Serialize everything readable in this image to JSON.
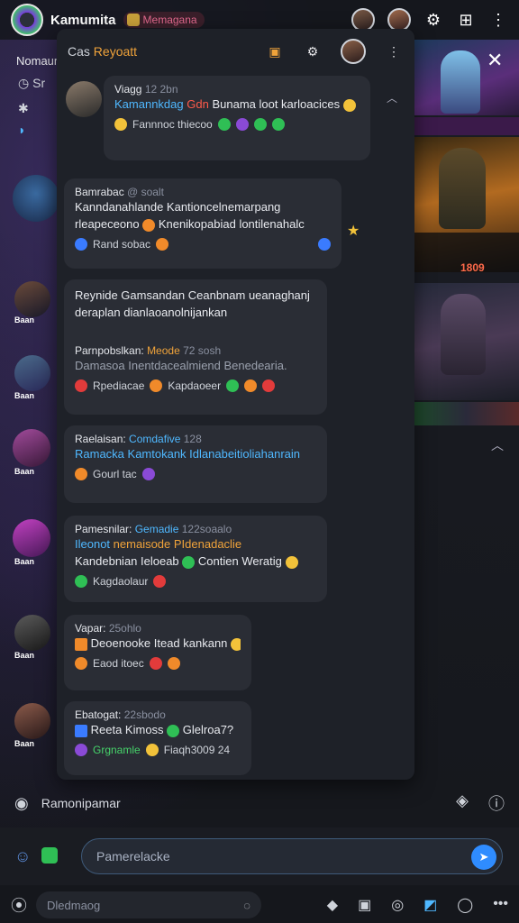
{
  "app": {
    "title": "Kamumita",
    "badge": "Memagana"
  },
  "rail": {
    "title": "Nomaun",
    "row1": "Sr",
    "labels": [
      "Baan",
      "Baan",
      "Baan",
      "Baan",
      "Baan",
      "Baan"
    ]
  },
  "panel": {
    "title_prefix": "Cas",
    "title_accent": "Reyoatt"
  },
  "messages": [
    {
      "name": "Viagg",
      "meta": "12 2bn",
      "line1_blue": "Kamannkdag",
      "line1_red": "Gdn",
      "line1_rest": "Bunama loot karloacices",
      "foot_text": "Fannnoc thiecoo"
    },
    {
      "name": "Bamrabac",
      "meta": "@ soalt",
      "line1": "Kanndanahlande Kantioncelnemarpang",
      "line2": "rleapeceono",
      "line2_rest": "Knenikopabiad lontilenahalc",
      "foot_text": "Rand sobac"
    },
    {
      "line1": "Reynide Gamsandan Ceanbnam ueanaghanj",
      "line2": "deraplan dianlaoanolnijankan",
      "name": "Parnpobslkan:",
      "meta_orange": "Meode",
      "meta": "72 sosh",
      "line3": "Damasoa Inentdacealmiend Benedearia.",
      "foot_text": "Rpediacae",
      "foot_text2": "Kapdaoeer"
    },
    {
      "name": "Raelaisan:",
      "meta_blue": "Comdafive",
      "meta": "128",
      "line1": "Ramacka Kamtokank Idlanabeitioliahanrain",
      "foot_text": "Gourl tac"
    },
    {
      "name": "Pamesnilar:",
      "meta_blue": "Gemadie",
      "meta": "122soaalo",
      "line1_blue": "Ileonot",
      "line1_orange": "nemaisode PIdenadaclie",
      "line2": "Kandebnian Ieloeab",
      "line2_rest": "Contien Weratig",
      "foot_text": "Kagdaolaur"
    },
    {
      "name": "Vapar:",
      "meta": "25ohlo",
      "line1": "Deoenooke Itead kankann",
      "foot_text": "Eaod itoec"
    },
    {
      "name": "Ebatogat:",
      "meta": "22sbodo",
      "line1": "Reeta Kimoss",
      "line1_rest": "Glelroa7?",
      "foot_green": "Grgnamle",
      "foot_text": "Fiaqh3009 24"
    }
  ],
  "game": {
    "score": "1809"
  },
  "status": {
    "text": "Ramonipamar"
  },
  "composer": {
    "placeholder": "Pamerelacke"
  },
  "bottom": {
    "search_placeholder": "Dledmaog"
  }
}
